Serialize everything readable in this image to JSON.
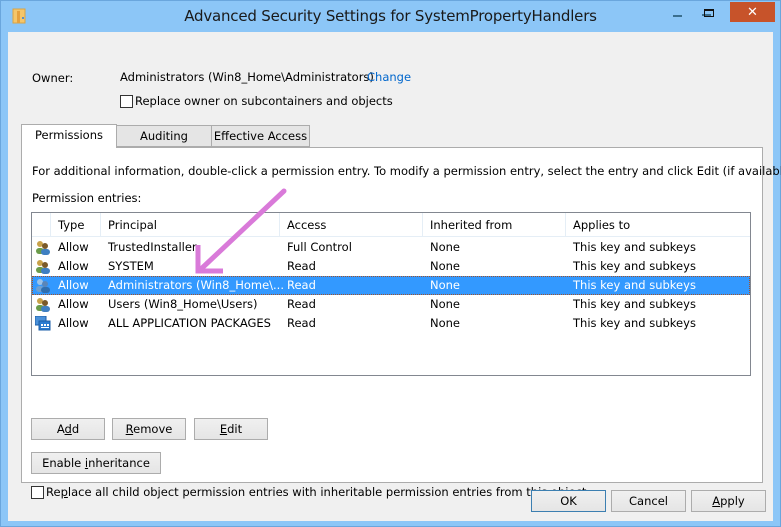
{
  "window": {
    "title": "Advanced Security Settings for SystemPropertyHandlers",
    "close_glyph": "✕"
  },
  "owner": {
    "label": "Owner:",
    "value": "Administrators (Win8_Home\\Administrators)",
    "change_link": "Change",
    "replace_checkbox_label": "Replace owner on subcontainers and objects",
    "replace_checked": false
  },
  "tabs": [
    {
      "label": "Permissions",
      "active": true
    },
    {
      "label": "Auditing",
      "active": false
    },
    {
      "label": "Effective Access",
      "active": false
    }
  ],
  "permissions": {
    "info_text": "For additional information, double-click a permission entry. To modify a permission entry, select the entry and click Edit (if available).",
    "entries_label": "Permission entries:",
    "columns": [
      "Type",
      "Principal",
      "Access",
      "Inherited from",
      "Applies to"
    ],
    "rows": [
      {
        "icon": "users-group-icon",
        "type": "Allow",
        "principal": "TrustedInstaller",
        "access": "Full Control",
        "inherited": "None",
        "applies": "This key and subkeys",
        "selected": false
      },
      {
        "icon": "users-group-icon",
        "type": "Allow",
        "principal": "SYSTEM",
        "access": "Read",
        "inherited": "None",
        "applies": "This key and subkeys",
        "selected": false
      },
      {
        "icon": "users-group-icon",
        "type": "Allow",
        "principal": "Administrators (Win8_Home\\...",
        "access": "Read",
        "inherited": "None",
        "applies": "This key and subkeys",
        "selected": true
      },
      {
        "icon": "users-group-icon",
        "type": "Allow",
        "principal": "Users (Win8_Home\\Users)",
        "access": "Read",
        "inherited": "None",
        "applies": "This key and subkeys",
        "selected": false
      },
      {
        "icon": "app-packages-icon",
        "type": "Allow",
        "principal": "ALL APPLICATION PACKAGES",
        "access": "Read",
        "inherited": "None",
        "applies": "This key and subkeys",
        "selected": false
      }
    ],
    "buttons": {
      "add_pre": "A",
      "add_key": "d",
      "add_post": "d",
      "remove_key": "R",
      "remove_post": "emove",
      "edit_key": "E",
      "edit_post": "dit",
      "inherit_pre": "Enable ",
      "inherit_key": "i",
      "inherit_post": "nheritance"
    },
    "replace_child_pre": "Re",
    "replace_child_key": "p",
    "replace_child_post": "lace all child object permission entries with inheritable permission entries from this object",
    "replace_child_checked": false
  },
  "footer": {
    "ok": "OK",
    "cancel": "Cancel",
    "apply_key": "A",
    "apply_post": "pply"
  },
  "annotation": {
    "arrow_color": "#d97ad9"
  }
}
